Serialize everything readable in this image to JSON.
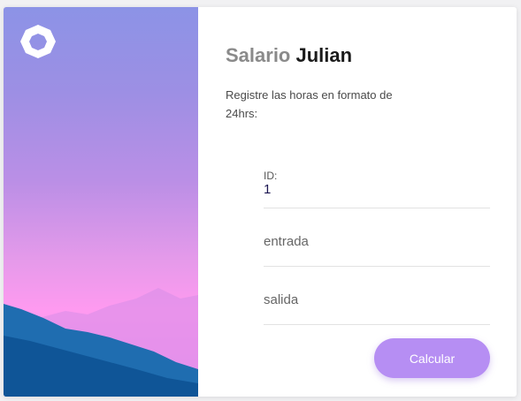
{
  "header": {
    "title_light": "Salario",
    "title_dark": "Julian",
    "subtitle": "Registre las horas en formato de 24hrs:"
  },
  "form": {
    "id_label": "ID:",
    "id_value": "1",
    "entrada_placeholder": "entrada",
    "salida_placeholder": "salida",
    "submit_label": "Calcular"
  },
  "colors": {
    "accent": "#b68ef3",
    "sidebar_top": "#8c93e6",
    "sidebar_pink": "#ff9af0",
    "mountain": "#145a9c"
  },
  "icons": {
    "logo": "octagon-ring-logo"
  }
}
